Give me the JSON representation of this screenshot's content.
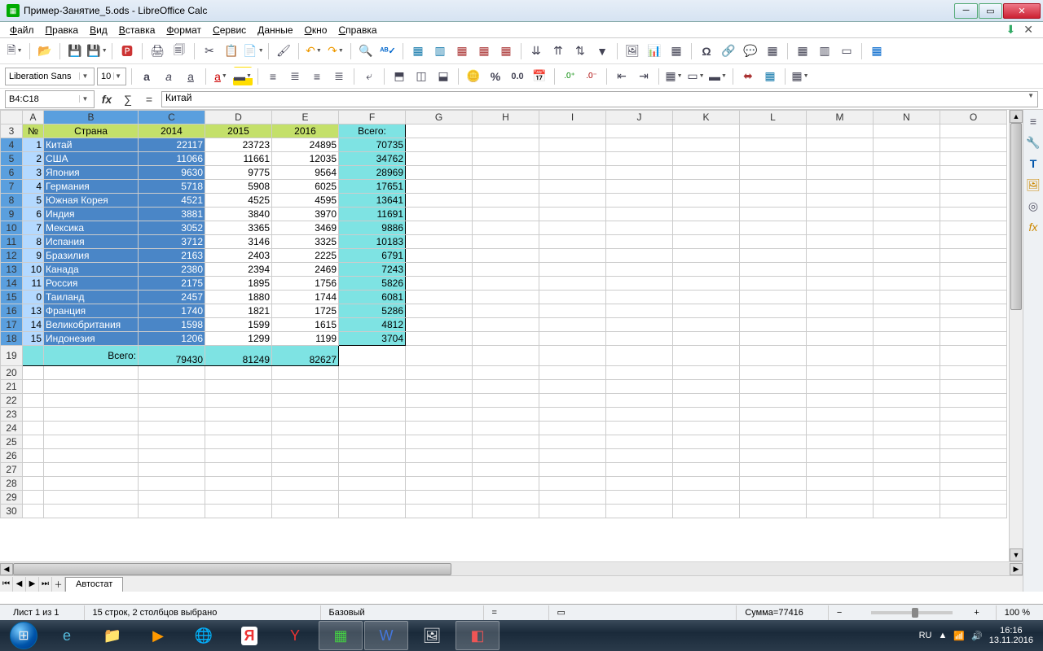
{
  "title": "Пример-Занятие_5.ods - LibreOffice Calc",
  "menu": [
    "Файл",
    "Правка",
    "Вид",
    "Вставка",
    "Формат",
    "Сервис",
    "Данные",
    "Окно",
    "Справка"
  ],
  "font": {
    "name": "Liberation Sans",
    "size": "10"
  },
  "namebox": "B4:C18",
  "formula": "Китай",
  "columns": [
    "A",
    "B",
    "C",
    "D",
    "E",
    "F",
    "G",
    "H",
    "I",
    "J",
    "K",
    "L",
    "M",
    "N",
    "O"
  ],
  "header": {
    "a": "№",
    "b": "Страна",
    "c": "2014",
    "d": "2015",
    "e": "2016",
    "f": "Всего:"
  },
  "rows": [
    {
      "n": 1,
      "country": "Китай",
      "y14": 22117,
      "y15": 23723,
      "y16": 24895,
      "tot": 70735
    },
    {
      "n": 2,
      "country": "США",
      "y14": 11066,
      "y15": 11661,
      "y16": 12035,
      "tot": 34762
    },
    {
      "n": 3,
      "country": "Япония",
      "y14": 9630,
      "y15": 9775,
      "y16": 9564,
      "tot": 28969
    },
    {
      "n": 4,
      "country": "Германия",
      "y14": 5718,
      "y15": 5908,
      "y16": 6025,
      "tot": 17651
    },
    {
      "n": 5,
      "country": "Южная Корея",
      "y14": 4521,
      "y15": 4525,
      "y16": 4595,
      "tot": 13641
    },
    {
      "n": 6,
      "country": "Индия",
      "y14": 3881,
      "y15": 3840,
      "y16": 3970,
      "tot": 11691
    },
    {
      "n": 7,
      "country": "Мексика",
      "y14": 3052,
      "y15": 3365,
      "y16": 3469,
      "tot": 9886
    },
    {
      "n": 8,
      "country": "Испания",
      "y14": 3712,
      "y15": 3146,
      "y16": 3325,
      "tot": 10183
    },
    {
      "n": 9,
      "country": "Бразилия",
      "y14": 2163,
      "y15": 2403,
      "y16": 2225,
      "tot": 6791
    },
    {
      "n": 10,
      "country": "Канада",
      "y14": 2380,
      "y15": 2394,
      "y16": 2469,
      "tot": 7243
    },
    {
      "n": 11,
      "country": "Россия",
      "y14": 2175,
      "y15": 1895,
      "y16": 1756,
      "tot": 5826
    },
    {
      "n": 0,
      "country": "Таиланд",
      "y14": 2457,
      "y15": 1880,
      "y16": 1744,
      "tot": 6081
    },
    {
      "n": 13,
      "country": "Франция",
      "y14": 1740,
      "y15": 1821,
      "y16": 1725,
      "tot": 5286
    },
    {
      "n": 14,
      "country": "Великобритания",
      "y14": 1598,
      "y15": 1599,
      "y16": 1615,
      "tot": 4812
    },
    {
      "n": 15,
      "country": "Индонезия",
      "y14": 1206,
      "y15": 1299,
      "y16": 1199,
      "tot": 3704
    }
  ],
  "totals": {
    "label": "Всего:",
    "y14": 79430,
    "y15": 81249,
    "y16": 82627
  },
  "tab": "Автостат",
  "status": {
    "sheet": "Лист 1 из 1",
    "sel": "15 строк, 2 столбцов выбрано",
    "style": "Базовый",
    "sum": "Сумма=77416",
    "zoom": "100 %"
  },
  "tray": {
    "lang": "RU",
    "time": "16:16",
    "date": "13.11.2016"
  }
}
